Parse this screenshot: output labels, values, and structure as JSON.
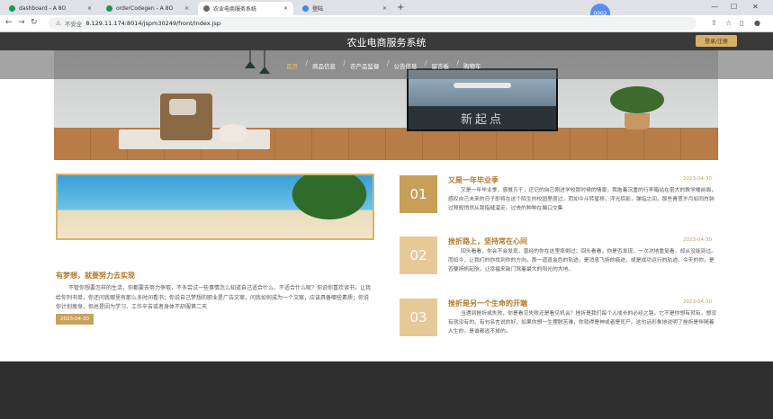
{
  "browser": {
    "tabs": [
      {
        "label": "dashboard - A 8O",
        "favicon_color": "#0f9d58"
      },
      {
        "label": "orderCodegen - A 8O",
        "favicon_color": "#0f9d58"
      },
      {
        "label": "农业电商服务系统",
        "favicon_color": "#666666"
      },
      {
        "label": "登陆",
        "favicon_color": "#4285f4"
      }
    ],
    "new_tab": "+",
    "profile_label": "0002",
    "address": {
      "warning": "不安全",
      "url": "8.129.11.174:8014/jspm30249/front/index.jsp"
    }
  },
  "site": {
    "title": "农业电商服务系统",
    "login_button": "登录/注册",
    "nav": [
      "首页",
      "商品信息",
      "农产品监督",
      "公告信息",
      "留言板",
      "购物车"
    ],
    "hero_words": "新起点"
  },
  "featured": {
    "title": "有梦想，就要努力去实现",
    "text": "不管你想要怎样的生活，你都要去努力争取，不多尝试一些事情怎么知道自己适合什么、不适合什么呢？你说你喜欢读书，让我给你列书单，你还问我哪里有那么多时间看书；你说自己梦想的职业是广告文案，问我如何成为一个文案，应该具备哪些素质；你说你计划瘦身，但总是因为学习、工作辛苦或者身体不舒服第二天",
    "date": "2023-04-30"
  },
  "list": [
    {
      "num": "01",
      "title": "又是一年毕业季",
      "date": "2023-04-30",
      "text": "又是一年毕业季，感慨万千，还记的自己刚进学校那时候的情景，我拖着沉重的行李箱站在偌大的教学楼前面，感叹自己未来的日子即将在这个陌生的校园里度过，而如今斗转星移，浮光掠影，弹指之间，那些青葱岁月如同白驹过隙般悄然从我指缝溜走。过去的种种在脑口交集"
    },
    {
      "num": "02",
      "title": "挫折路上，坚持常在心间",
      "date": "2023-04-30",
      "text": "回头看看，你会不会发现，曾经的你在这里摔倒过；回头看看，你是否发现，一次次地重复看，却从没能到过。而如今，让我们的你找到你的方向。那一道道金色的轨迹，是消息飞扬的痕迹，或是成功运行的轨迹。今天的你，是否要扬帆起航，让幸福来敲门驾着最大的阳光的大地。"
    },
    {
      "num": "03",
      "title": "挫折是另一个生命的开端",
      "date": "2023-04-30",
      "text": "当遇到挫折或失败，你是看见失败还是看见机会？挫折是我们每个人成长的必经之路，它不是你想有就有，想没有就没有的。有句名言说的好，如果你想一生摆脱苦难，你就得是神或者是死尸。这句话形象地说明了挫折是伴随着人生的，是谁都逃不掉的。"
    }
  ]
}
